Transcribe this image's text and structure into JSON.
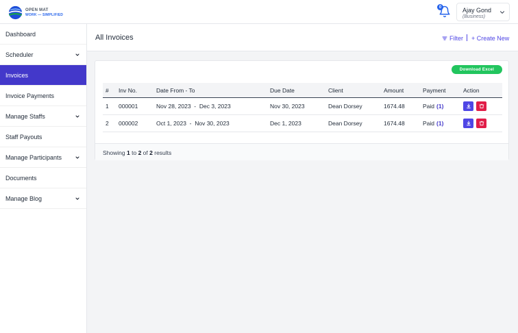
{
  "brand": {
    "line1": "OPEN MAT",
    "line2": "WORK — SIMPLIFIED"
  },
  "header": {
    "notification_count": "0",
    "user_name": "Ajay Gond",
    "user_role": "(Business)"
  },
  "sidebar": {
    "items": [
      {
        "label": "Dashboard",
        "has_submenu": false
      },
      {
        "label": "Scheduler",
        "has_submenu": true
      },
      {
        "label": "Invoices",
        "has_submenu": false,
        "active": true
      },
      {
        "label": "Invoice Payments",
        "has_submenu": false
      },
      {
        "label": "Manage Staffs",
        "has_submenu": true
      },
      {
        "label": "Staff Payouts",
        "has_submenu": false
      },
      {
        "label": "Manage Participants",
        "has_submenu": true
      },
      {
        "label": "Documents",
        "has_submenu": false
      },
      {
        "label": "Manage Blog",
        "has_submenu": true
      }
    ]
  },
  "page": {
    "title": "All Invoices",
    "filter_label": "Filter",
    "create_label": "+ Create New",
    "download_excel_label": "Download Excel"
  },
  "table": {
    "headers": [
      "#",
      "Inv No.",
      "Date From - To",
      "Due Date",
      "Client",
      "Amount",
      "Payment",
      "Action"
    ],
    "rows": [
      {
        "index": "1",
        "inv_no": "000001",
        "date_range": "Nov 28, 2023  -  Dec 3, 2023",
        "due_date": "Nov 30, 2023",
        "client": "Dean Dorsey",
        "amount": "1674.48",
        "payment_status": "Paid",
        "payment_count": "(1)"
      },
      {
        "index": "2",
        "inv_no": "000002",
        "date_range": "Oct 1, 2023  -  Nov 30, 2023",
        "due_date": "Dec 1, 2023",
        "client": "Dean Dorsey",
        "amount": "1674.48",
        "payment_status": "Paid",
        "payment_count": "(1)"
      }
    ]
  },
  "pagination": {
    "prefix": "Showing",
    "from": "1",
    "to_word": "to",
    "to": "2",
    "of_word": "of",
    "total": "2",
    "suffix": "results"
  },
  "colors": {
    "accent": "#4338ca",
    "link": "#4f46e5",
    "success": "#22c55e",
    "danger": "#e11d48"
  },
  "icons": {
    "logo": "globe-logo-icon",
    "notification": "bell-icon",
    "user_menu": "chevron-down-icon",
    "filter": "filter-lines-icon",
    "download": "download-icon",
    "delete": "trash-icon"
  }
}
